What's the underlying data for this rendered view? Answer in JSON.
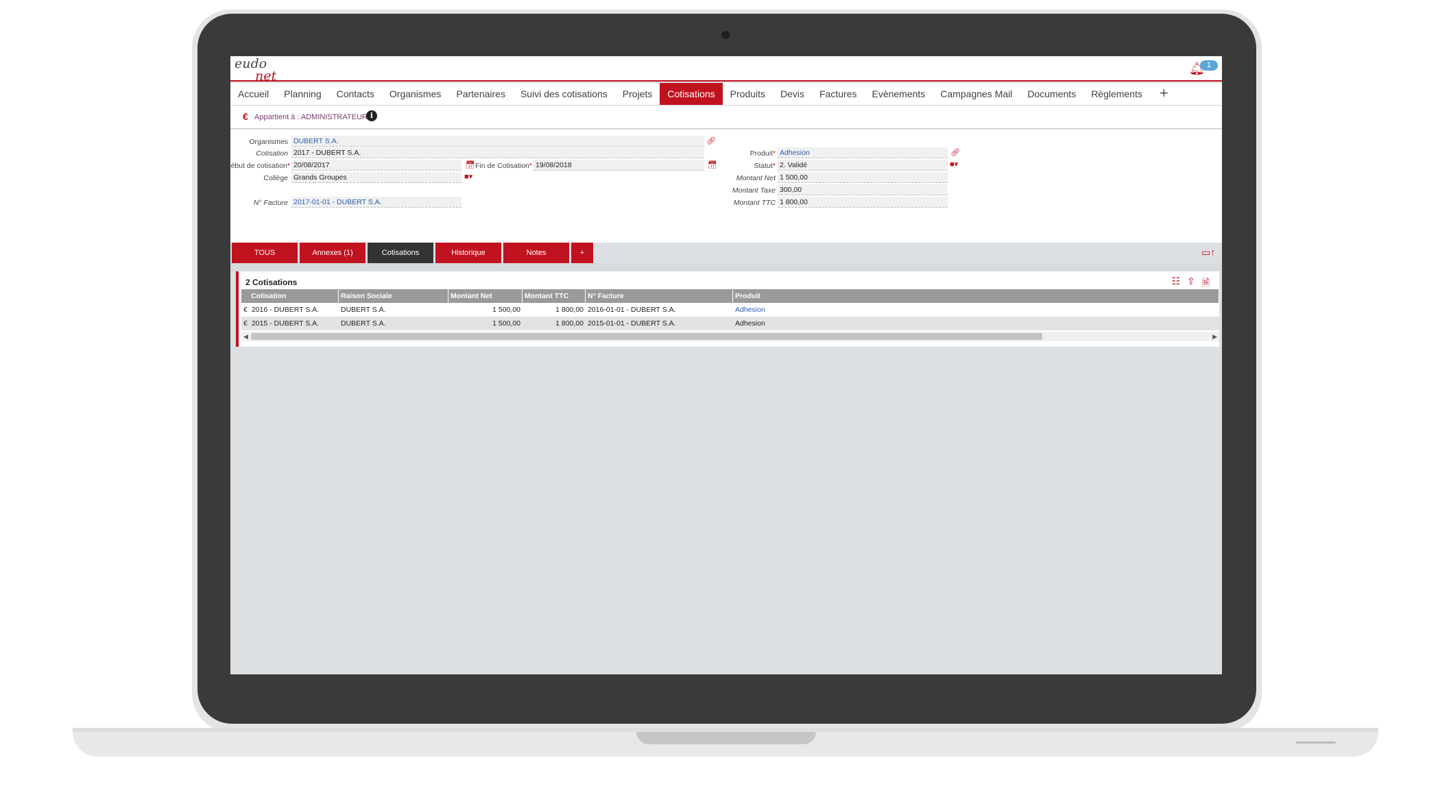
{
  "app": {
    "logo_line1": "eudo",
    "logo_line2": "net",
    "notification_count": "1"
  },
  "nav": {
    "tabs": [
      "Accueil",
      "Planning",
      "Contacts",
      "Organismes",
      "Partenaires",
      "Suivi des cotisations",
      "Projets",
      "Cotisations",
      "Produits",
      "Devis",
      "Factures",
      "Evènements",
      "Campagnes Mail",
      "Documents",
      "Règlements"
    ],
    "active": "Cotisations",
    "plus": "+"
  },
  "owner": {
    "euro": "€",
    "label": "Appartient à : ADMINISTRATEUR",
    "info": "i"
  },
  "form": {
    "organismes": {
      "label": "Organismes",
      "value": "DUBERT S.A."
    },
    "cotisation": {
      "label": "Cotisation",
      "value": "2017 - DUBERT S.A."
    },
    "debut": {
      "label": "Début de cotisation",
      "value": "20/08/2017"
    },
    "fin": {
      "label": "Fin de Cotisation",
      "value": "19/08/2018"
    },
    "college": {
      "label": "Collège",
      "value": "Grands Groupes"
    },
    "facture": {
      "label": "N° Facture",
      "value": "2017-01-01 - DUBERT S.A."
    },
    "produit": {
      "label": "Produit",
      "value": "Adhesion"
    },
    "statut": {
      "label": "Statut",
      "value": "2. Validé"
    },
    "montant_net": {
      "label": "Montant Net",
      "value": "1 500,00"
    },
    "montant_taxe": {
      "label": "Montant Taxe",
      "value": "300,00"
    },
    "montant_ttc": {
      "label": "Montant TTC",
      "value": "1 800,00"
    },
    "required_mark": "*"
  },
  "subtabs": {
    "items": [
      "TOUS",
      "Annexes (1)",
      "Cotisations",
      "Historique",
      "Notes",
      "+"
    ],
    "active": "Cotisations"
  },
  "list": {
    "title": "2 Cotisations",
    "columns": [
      "Cotisation",
      "Raison Sociale",
      "Montant Net",
      "Montant TTC",
      "N° Facture",
      "Produit"
    ],
    "rows": [
      {
        "cotisation": "2016 - DUBERT S.A.",
        "raison": "DUBERT S.A.",
        "net": "1 500,00",
        "ttc": "1 800,00",
        "facture": "2016-01-01 - DUBERT S.A.",
        "produit": "Adhesion"
      },
      {
        "cotisation": "2015 - DUBERT S.A.",
        "raison": "DUBERT S.A.",
        "net": "1 500,00",
        "ttc": "1 800,00",
        "facture": "2015-01-01 - DUBERT S.A.",
        "produit": "Adhesion"
      }
    ]
  },
  "colors": {
    "brand_red": "#c1121f",
    "link_blue": "#2a5db0",
    "badge_blue": "#5aa6d8"
  }
}
